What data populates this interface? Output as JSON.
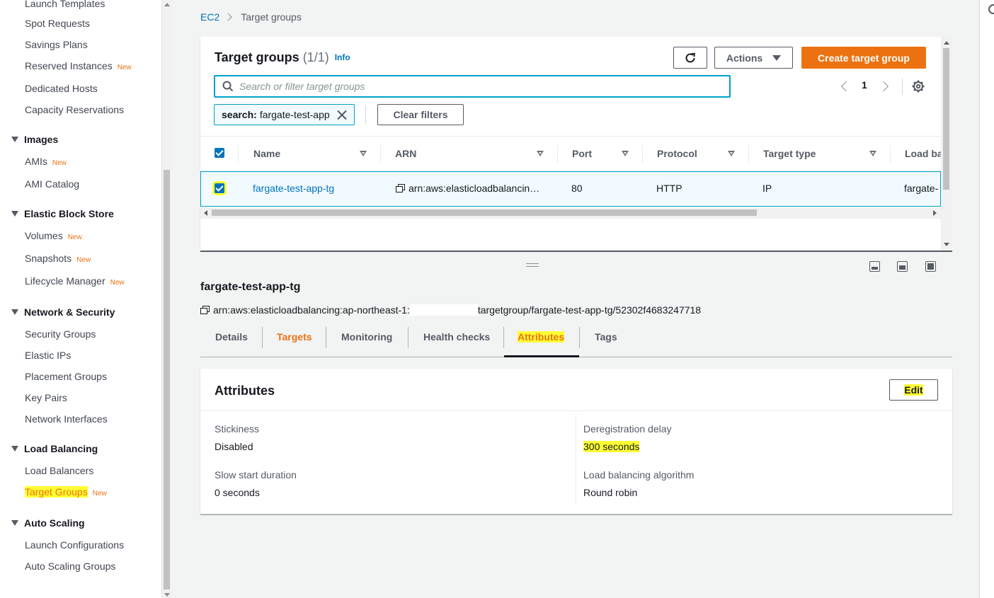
{
  "sidebar": {
    "items": [
      {
        "label": "Launch Templates",
        "new": ""
      },
      {
        "label": "Spot Requests",
        "new": ""
      },
      {
        "label": "Savings Plans",
        "new": ""
      },
      {
        "label": "Reserved Instances",
        "new": "New"
      },
      {
        "label": "Dedicated Hosts",
        "new": ""
      },
      {
        "label": "Capacity Reservations",
        "new": ""
      }
    ],
    "images": {
      "title": "Images",
      "items": [
        {
          "label": "AMIs",
          "new": "New"
        },
        {
          "label": "AMI Catalog",
          "new": ""
        }
      ]
    },
    "ebs": {
      "title": "Elastic Block Store",
      "items": [
        {
          "label": "Volumes",
          "new": "New"
        },
        {
          "label": "Snapshots",
          "new": "New"
        },
        {
          "label": "Lifecycle Manager",
          "new": "New"
        }
      ]
    },
    "network": {
      "title": "Network & Security",
      "items": [
        {
          "label": "Security Groups"
        },
        {
          "label": "Elastic IPs"
        },
        {
          "label": "Placement Groups"
        },
        {
          "label": "Key Pairs"
        },
        {
          "label": "Network Interfaces"
        }
      ]
    },
    "lb": {
      "title": "Load Balancing",
      "items": [
        {
          "label": "Load Balancers",
          "new": ""
        },
        {
          "label": "Target Groups",
          "new": "New"
        }
      ]
    },
    "as": {
      "title": "Auto Scaling",
      "items": [
        {
          "label": "Launch Configurations"
        },
        {
          "label": "Auto Scaling Groups"
        }
      ]
    }
  },
  "breadcrumb": {
    "root": "EC2",
    "current": "Target groups"
  },
  "panel": {
    "title": "Target groups",
    "count": "(1/1)",
    "info": "Info",
    "actions_label": "Actions",
    "create_label": "Create target group",
    "search_placeholder": "Search or filter target groups",
    "page_number": "1",
    "filter_key": "search:",
    "filter_value": "fargate-test-app",
    "clear_filters": "Clear filters"
  },
  "table": {
    "columns": [
      "Name",
      "ARN",
      "Port",
      "Protocol",
      "Target type",
      "Load ba"
    ],
    "row": {
      "name": "fargate-test-app-tg",
      "arn": "arn:aws:elasticloadbalancin…",
      "port": "80",
      "protocol": "HTTP",
      "target_type": "IP",
      "load_balancer": "fargate-"
    }
  },
  "detail": {
    "title": "fargate-test-app-tg",
    "arn_prefix": "arn:aws:elasticloadbalancing:ap-northeast-1:",
    "arn_suffix": "targetgroup/fargate-test-app-tg/52302f4683247718",
    "tabs": [
      "Details",
      "Targets",
      "Monitoring",
      "Health checks",
      "Attributes",
      "Tags"
    ]
  },
  "attributes": {
    "title": "Attributes",
    "edit_label": "Edit",
    "stickiness_label": "Stickiness",
    "stickiness_value": "Disabled",
    "slow_start_label": "Slow start duration",
    "slow_start_value": "0 seconds",
    "dereg_label": "Deregistration delay",
    "dereg_value": "300 seconds",
    "algo_label": "Load balancing algorithm",
    "algo_value": "Round robin"
  },
  "colors": {
    "accent": "#ec7211",
    "link": "#0073bb",
    "highlight": "#ffff33"
  }
}
